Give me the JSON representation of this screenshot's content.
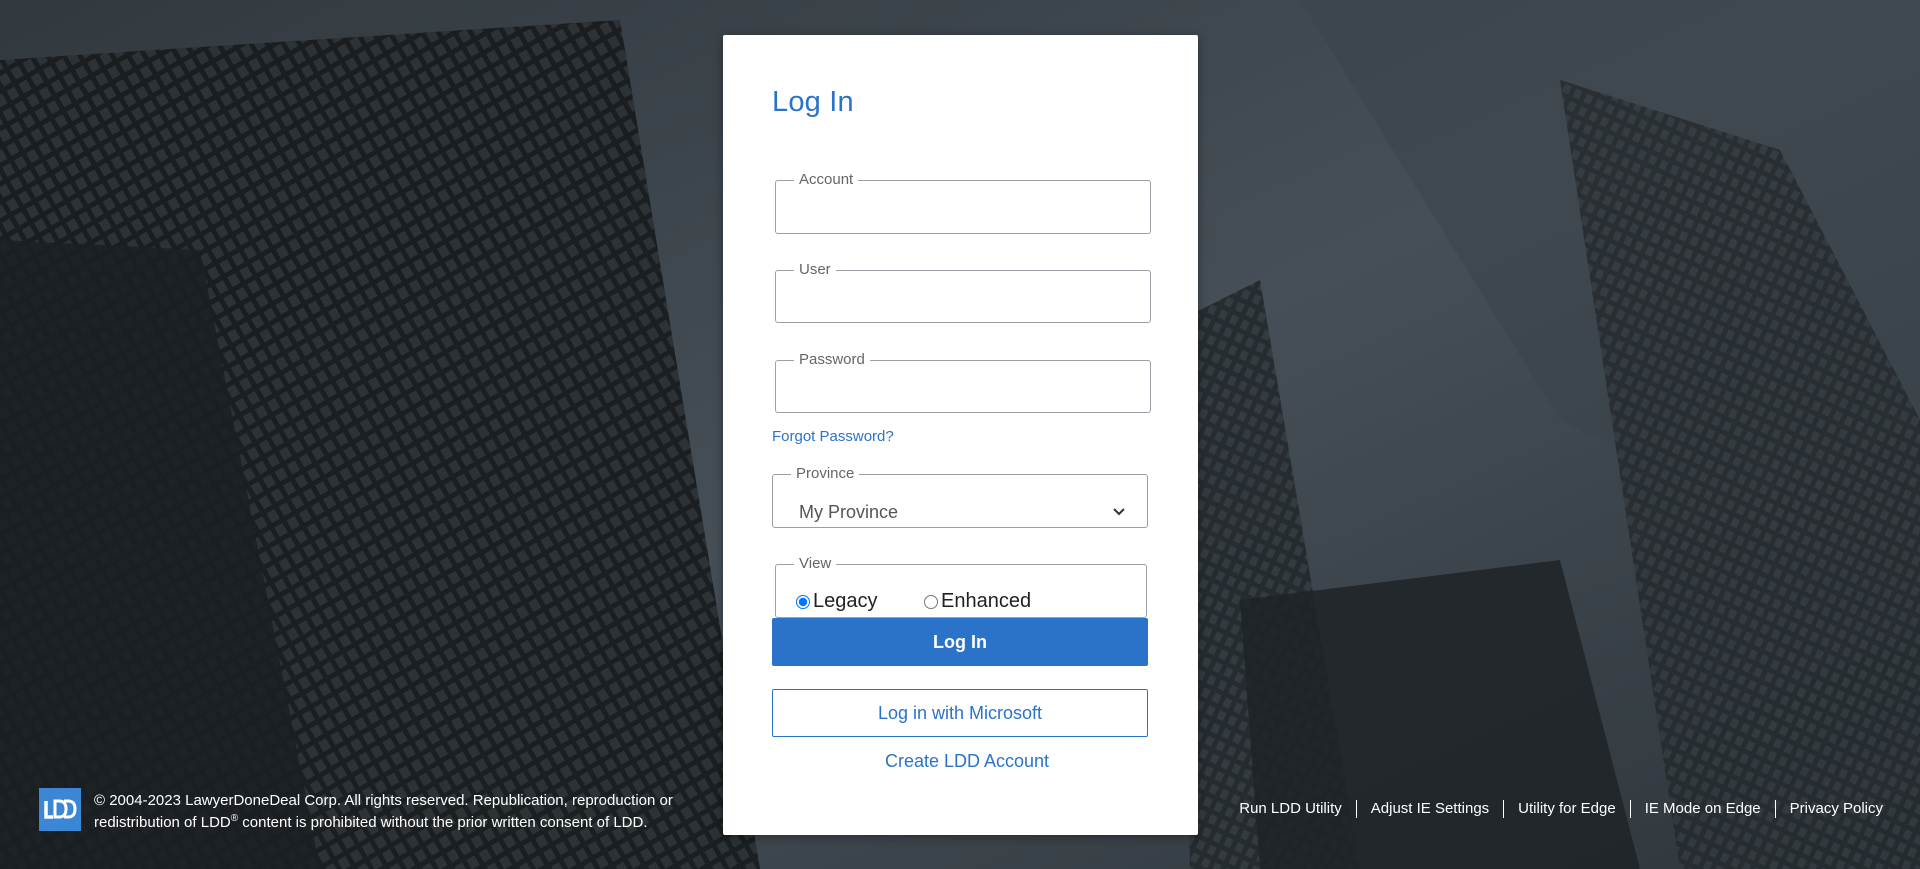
{
  "login": {
    "title": "Log In",
    "account_label": "Account",
    "user_label": "User",
    "password_label": "Password",
    "forgot_password": "Forgot Password?",
    "province_label": "Province",
    "province_value": "My Province",
    "view_label": "View",
    "view_options": [
      "Legacy",
      "Enhanced"
    ],
    "view_selected": "Legacy",
    "login_button": "Log In",
    "microsoft_button": "Log in with Microsoft",
    "create_account": "Create LDD Account"
  },
  "footer": {
    "logo_text": "LDD",
    "copyright_line1": "© 2004-2023 LawyerDoneDeal Corp. All rights reserved. Republication, reproduction or",
    "copyright_line2_pre": "redistribution of LDD",
    "copyright_reg": "®",
    "copyright_line2_post": " content is prohibited without the prior written consent of LDD.",
    "links": [
      "Run LDD Utility",
      "Adjust IE Settings",
      "Utility for Edge",
      "IE Mode on Edge",
      "Privacy Policy"
    ]
  },
  "colors": {
    "accent": "#2a73c9",
    "logo_bg": "#3b87d6",
    "background": "#2a3036"
  },
  "icons": {
    "logo": "ldd-logo",
    "province_dropdown": "chevron-down-icon"
  }
}
